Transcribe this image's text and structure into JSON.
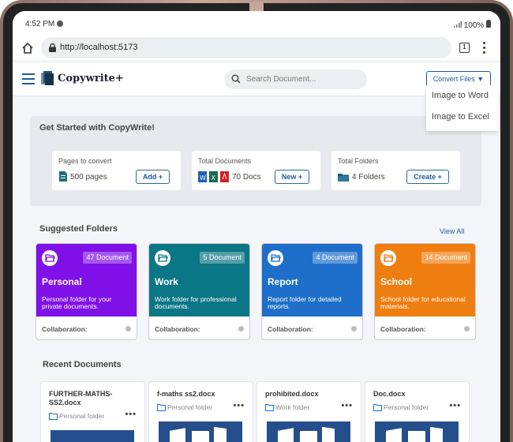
{
  "status": {
    "time": "4:52 PM",
    "battery": "100%"
  },
  "browser": {
    "url": "http://localhost:5173",
    "tab_count": "1"
  },
  "header": {
    "brand": "Copywrite+",
    "search_placeholder": "Search Document...",
    "convert_label": "Convert Files ▼"
  },
  "convert_menu": [
    "Image to Word",
    "Image to Excel"
  ],
  "get_started": {
    "title": "Get Started with CopyWrite!",
    "stats": [
      {
        "label": "Pages to convert",
        "value": "500 pages",
        "button": "Add +"
      },
      {
        "label": "Total Documents",
        "value": "70 Docs",
        "button": "New +"
      },
      {
        "label": "Total Folders",
        "value": "4 Folders",
        "button": "Create +"
      }
    ]
  },
  "suggested": {
    "title": "Suggested Folders",
    "view_all": "View All",
    "folders": [
      {
        "name": "Personal",
        "count": "47 Document",
        "desc": "Personal folder for your private documents.",
        "collab": "Collaboration:",
        "color": "#7f10e8"
      },
      {
        "name": "Work",
        "count": "5 Document",
        "desc": "Work folder for professional documents.",
        "collab": "Collaboration:",
        "color": "#0b7685"
      },
      {
        "name": "Report",
        "count": "4 Document",
        "desc": "Report folder for detailed reports.",
        "collab": "Collaboration:",
        "color": "#1e6fc9"
      },
      {
        "name": "School",
        "count": "14 Document",
        "desc": "School folder for educational materials.",
        "collab": "Collaboration:",
        "color": "#ef7e10"
      }
    ]
  },
  "recent": {
    "title": "Recent Documents",
    "docs": [
      {
        "name": "FURTHER-MATHS-SS2.docx",
        "folder": "Personal folder",
        "more": "•••"
      },
      {
        "name": "f-maths ss2.docx",
        "folder": "Personal folder",
        "more": "•••"
      },
      {
        "name": "prohibited.docx",
        "folder": "Work folder",
        "more": "•••"
      },
      {
        "name": "Doc.docx",
        "folder": "Personal folder",
        "more": "•••"
      }
    ]
  }
}
